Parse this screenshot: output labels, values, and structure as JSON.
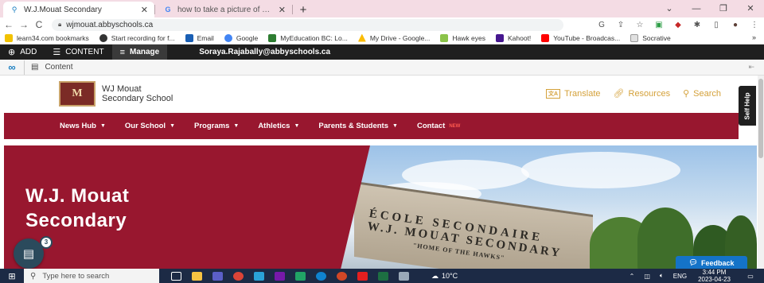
{
  "browser": {
    "tabs": [
      {
        "title": "W.J.Mouat Secondary",
        "close": "✕"
      },
      {
        "title": "how to take a picture of your scr",
        "close": "✕"
      }
    ],
    "new_tab": "+",
    "window_controls": [
      "⌄",
      "—",
      "❐",
      "✕"
    ],
    "nav": {
      "back": "←",
      "forward": "→",
      "reload": "C"
    },
    "url": "wjmouat.abbyschools.ca",
    "toolbar_icons": [
      "G",
      "⇪",
      "☆",
      "▣",
      "◆",
      "✱",
      "▯",
      "●",
      "⋮"
    ],
    "bookmarks": [
      {
        "label": "learn34.com bookmarks",
        "color": "#f2c200"
      },
      {
        "label": "Start recording for f...",
        "color": "#333333"
      },
      {
        "label": "Email",
        "color": "#1a5fb4"
      },
      {
        "label": "Google",
        "color": "#4285f4"
      },
      {
        "label": "MyEducation BC: Lo...",
        "color": "#2e7d32"
      },
      {
        "label": "My Drive - Google...",
        "color": "#fbbc05"
      },
      {
        "label": "Hawk eyes",
        "color": "#8bc34a"
      },
      {
        "label": "Kahoot!",
        "color": "#46178f"
      },
      {
        "label": "YouTube - Broadcas...",
        "color": "#ff0000"
      },
      {
        "label": "Socrative",
        "color": "#e0e0e0"
      }
    ],
    "bookmarks_more": "»"
  },
  "cms": {
    "add": "ADD",
    "content": "CONTENT",
    "manage": "Manage",
    "user_email": "Soraya.Rajabally@abbyschools.ca",
    "content_bar_label": "Content",
    "collapse": "⇤"
  },
  "site": {
    "crest_text": "M",
    "school_name_line1": "WJ Mouat",
    "school_name_line2": "Secondary School",
    "header_links": {
      "translate": "Translate",
      "translate_box": "文A",
      "resources": "Resources",
      "search": "Search"
    },
    "self_help": "Self Help",
    "nav": [
      {
        "label": "News Hub",
        "caret": "▼"
      },
      {
        "label": "Our School",
        "caret": "▼"
      },
      {
        "label": "Programs",
        "caret": "▼"
      },
      {
        "label": "Athletics",
        "caret": "▼"
      },
      {
        "label": "Parents & Students",
        "caret": "▼"
      },
      {
        "label": "Contact",
        "badge": "NEW"
      }
    ],
    "hero_title_line1": "W.J. Mouat",
    "hero_title_line2": "Secondary",
    "building_sign_line1": "ÉCOLE SECONDAIRE",
    "building_sign_line2": "W.J. MOUAT SECONDARY",
    "building_sign_line3": "\"HOME OF THE HAWKS\"",
    "notification_count": "3",
    "feedback": "Feedback"
  },
  "taskbar": {
    "search_placeholder": "Type here to search",
    "weather": "10°C",
    "language": "ENG",
    "time": "3:44 PM",
    "date": "2023-04-23"
  }
}
